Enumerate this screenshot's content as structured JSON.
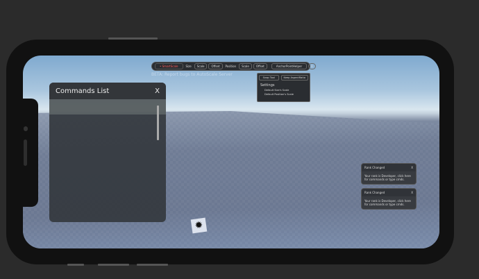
{
  "topbar": {
    "brand": "• SmartScale",
    "size_label": "Size",
    "size_scale": "Scale",
    "size_offset": "Offset",
    "position_label": "Position",
    "pos_scale": "Scale",
    "pos_offset": "Offset",
    "anchor": "AnchorPointHelper",
    "counter": "0"
  },
  "beta_text": "BETA: Report bugs to AutoScale Server",
  "settings": {
    "snap": "Snap Tool",
    "keep": "Keep AspectRatio",
    "heading": "Settings",
    "item1": "Default Size's Scale",
    "item2": "Default Position's Scale"
  },
  "commands": {
    "title": "Commands List",
    "close": "X"
  },
  "notifications": [
    {
      "title": "Rank Changed",
      "close": "X",
      "body": "Your rank is Developer, click here for commands or type cmds."
    },
    {
      "title": "Rank Changed",
      "close": "X",
      "body": "Your rank is Developer, click here for commands or type cmds."
    }
  ],
  "icons": {
    "tool": "sun-gear-icon"
  }
}
